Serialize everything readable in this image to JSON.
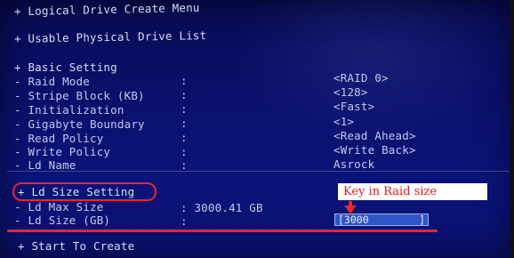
{
  "menu": {
    "logical_drive_create": "+ Logical Drive Create Menu",
    "usable_physical": "+ Usable Physical Drive List",
    "basic_setting": "+ Basic Setting"
  },
  "settings": [
    {
      "label": "- Raid Mode",
      "colon": ":",
      "value": "<RAID 0>"
    },
    {
      "label": "- Stripe Block (KB)",
      "colon": ":",
      "value": "<128>"
    },
    {
      "label": "- Initialization",
      "colon": ":",
      "value": "<Fast>"
    },
    {
      "label": "- Gigabyte Boundary",
      "colon": ":",
      "value": "<1>"
    },
    {
      "label": "- Read Policy",
      "colon": ":",
      "value": "<Read Ahead>"
    },
    {
      "label": "- Write Policy",
      "colon": ":",
      "value": "<Write Back>"
    },
    {
      "label": "- Ld Name",
      "colon": ":",
      "value": "Asrock"
    }
  ],
  "ld_size": {
    "header": "+ Ld Size Setting",
    "max_label": "- Ld Max Size",
    "max_value": ": 3000.41 GB",
    "size_label": "- Ld Size (GB)",
    "size_colon": ":",
    "input_value": "[3000",
    "input_close": "]"
  },
  "annotation": {
    "key_label": "Key in Raid size",
    "highlight_color": "#e8272b"
  },
  "start_create": "+ Start To Create"
}
